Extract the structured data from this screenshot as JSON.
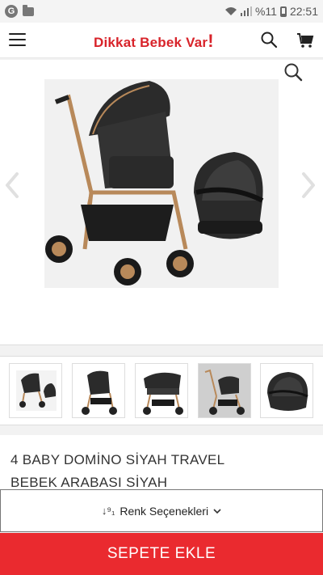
{
  "status_bar": {
    "battery": "%11",
    "time": "22:51"
  },
  "header": {
    "logo_text_1": "Dikkat ",
    "logo_text_2": "Bebek Var",
    "logo_bang": "!"
  },
  "gallery": {
    "thumbnail_count": 5,
    "active_thumbnail": 4
  },
  "product": {
    "title": "4 BABY DOMİNO SİYAH TRAVEL BEBEK ARABASI SİYAH"
  },
  "color_selector": {
    "sort_glyph": "↓⁹₁",
    "label": "Renk Seçenekleri"
  },
  "actions": {
    "add_to_cart": "SEPETE EKLE"
  },
  "colors": {
    "brand_red": "#d8232a",
    "button_red": "#ea2a2f",
    "frame_gold": "#b8895a",
    "fabric": "#2b2b2b"
  }
}
